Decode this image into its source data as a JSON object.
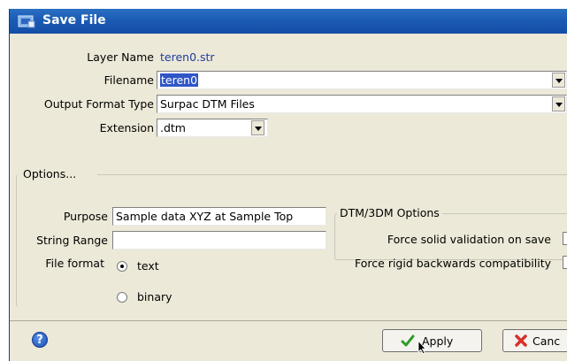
{
  "window": {
    "title": "Save File",
    "title_icon": "save-file-window-icon"
  },
  "layer_name": {
    "label": "Layer Name",
    "value": "teren0.str"
  },
  "filename": {
    "label": "Filename",
    "value": "teren0"
  },
  "output_format": {
    "label": "Output Format Type",
    "value": "Surpac DTM Files"
  },
  "extension": {
    "label": "Extension",
    "value": ".dtm"
  },
  "options": {
    "title": "Options...",
    "purpose": {
      "label": "Purpose",
      "value": "Sample data XYZ at Sample Top"
    },
    "string_range": {
      "label": "String Range",
      "value": ""
    },
    "file_format": {
      "label": "File format",
      "selected": "text",
      "options": [
        "text",
        "binary"
      ]
    },
    "dtm": {
      "title": "DTM/3DM Options",
      "force_solid": "Force solid validation on save",
      "force_rigid": "Force rigid backwards compatibility"
    }
  },
  "buttons": {
    "help": "?",
    "apply": "Apply",
    "cancel": "Canc"
  },
  "colors": {
    "title_bar": "#1b5bb5",
    "dialog_bg": "#ece9d8",
    "selection": "#2f55c6"
  }
}
